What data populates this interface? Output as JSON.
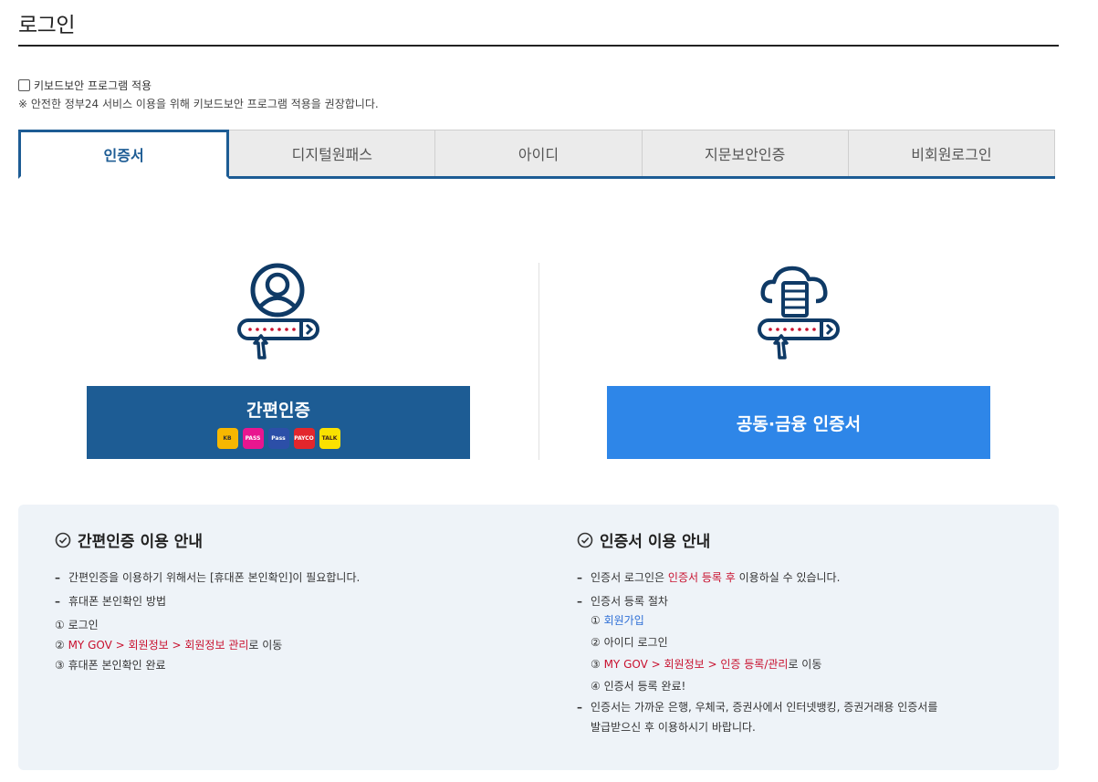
{
  "page": {
    "title": "로그인"
  },
  "keyboard_security": {
    "checkbox_label": "키보드보안 프로그램 적용",
    "notice": "※ 안전한 정부24 서비스 이용을 위해 키보드보안 프로그램 적용을 권장합니다."
  },
  "tabs": [
    {
      "label": "인증서",
      "active": true
    },
    {
      "label": "디지털원패스",
      "active": false
    },
    {
      "label": "아이디",
      "active": false
    },
    {
      "label": "지문보안인증",
      "active": false
    },
    {
      "label": "비회원로그인",
      "active": false
    }
  ],
  "methods": {
    "easy_auth": {
      "label": "간편인증",
      "icon": "person-password-icon",
      "badges": [
        {
          "name": "kb-badge",
          "text": "KB"
        },
        {
          "name": "pass-badge",
          "text": "PASS"
        },
        {
          "name": "samsung-pass-badge",
          "text": "Pass"
        },
        {
          "name": "payco-badge",
          "text": "PAYCO"
        },
        {
          "name": "kakao-talk-badge",
          "text": "TALK"
        }
      ]
    },
    "cert": {
      "label": "공동·금융 인증서",
      "icon": "cloud-server-password-icon"
    }
  },
  "info": {
    "easy": {
      "heading": "간편인증 이용 안내",
      "lines": [
        "간편인증을 이용하기 위해서는 [휴대폰 본인확인]이 필요합니다.",
        "휴대폰 본인확인 방법"
      ],
      "steps": {
        "s1": "① 로그인",
        "s2_num": "② ",
        "s2_red": "MY GOV > 회원정보 > 회원정보 관리",
        "s2_tail": "로 이동",
        "s3": "③ 휴대폰 본인확인 완료"
      }
    },
    "cert": {
      "heading": "인증서 이용 안내",
      "line1_a": "인증서 로그인은 ",
      "line1_red": "인증서 등록 후",
      "line1_b": " 이용하실 수 있습니다.",
      "line2": "인증서 등록 절차",
      "steps": {
        "s1_num": "① ",
        "s1_link": "회원가입",
        "s2": "② 아이디 로그인",
        "s3_num": "③ ",
        "s3_red": "MY GOV > 회원정보 > 인증 등록/관리",
        "s3_tail": "로 이동",
        "s4": "④ 인증서 등록 완료!"
      },
      "line3a": "인증서는 가까운 은행, 우체국, 증권사에서 인터넷뱅킹, 증권거래용 인증서를",
      "line3b": "발급받으신 후 이용하시기 바랍니다."
    }
  },
  "colors": {
    "primary": "#1d5c94",
    "cert_button": "#2e86e8",
    "accent_red": "#c8102e",
    "link_blue": "#2e6fd6"
  }
}
